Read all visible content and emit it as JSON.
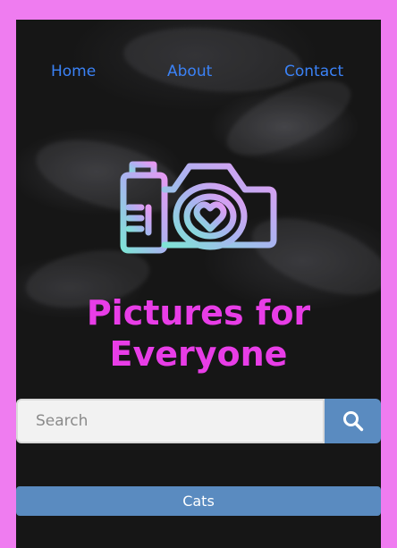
{
  "nav": {
    "items": [
      {
        "label": "Home"
      },
      {
        "label": "About"
      },
      {
        "label": "Contact"
      }
    ]
  },
  "hero": {
    "logo_icon": "camera-heart-icon",
    "title_line1": "Pictures for",
    "title_line2": "Everyone",
    "title_color": "#e83de7"
  },
  "search": {
    "placeholder": "Search",
    "value": "",
    "button_icon": "search-icon",
    "button_color": "#5a8bc0"
  },
  "categories": [
    {
      "label": "Cats"
    }
  ],
  "colors": {
    "frame": "#ef7cf0",
    "nav_link": "#3b82f6",
    "background": "#161616"
  }
}
